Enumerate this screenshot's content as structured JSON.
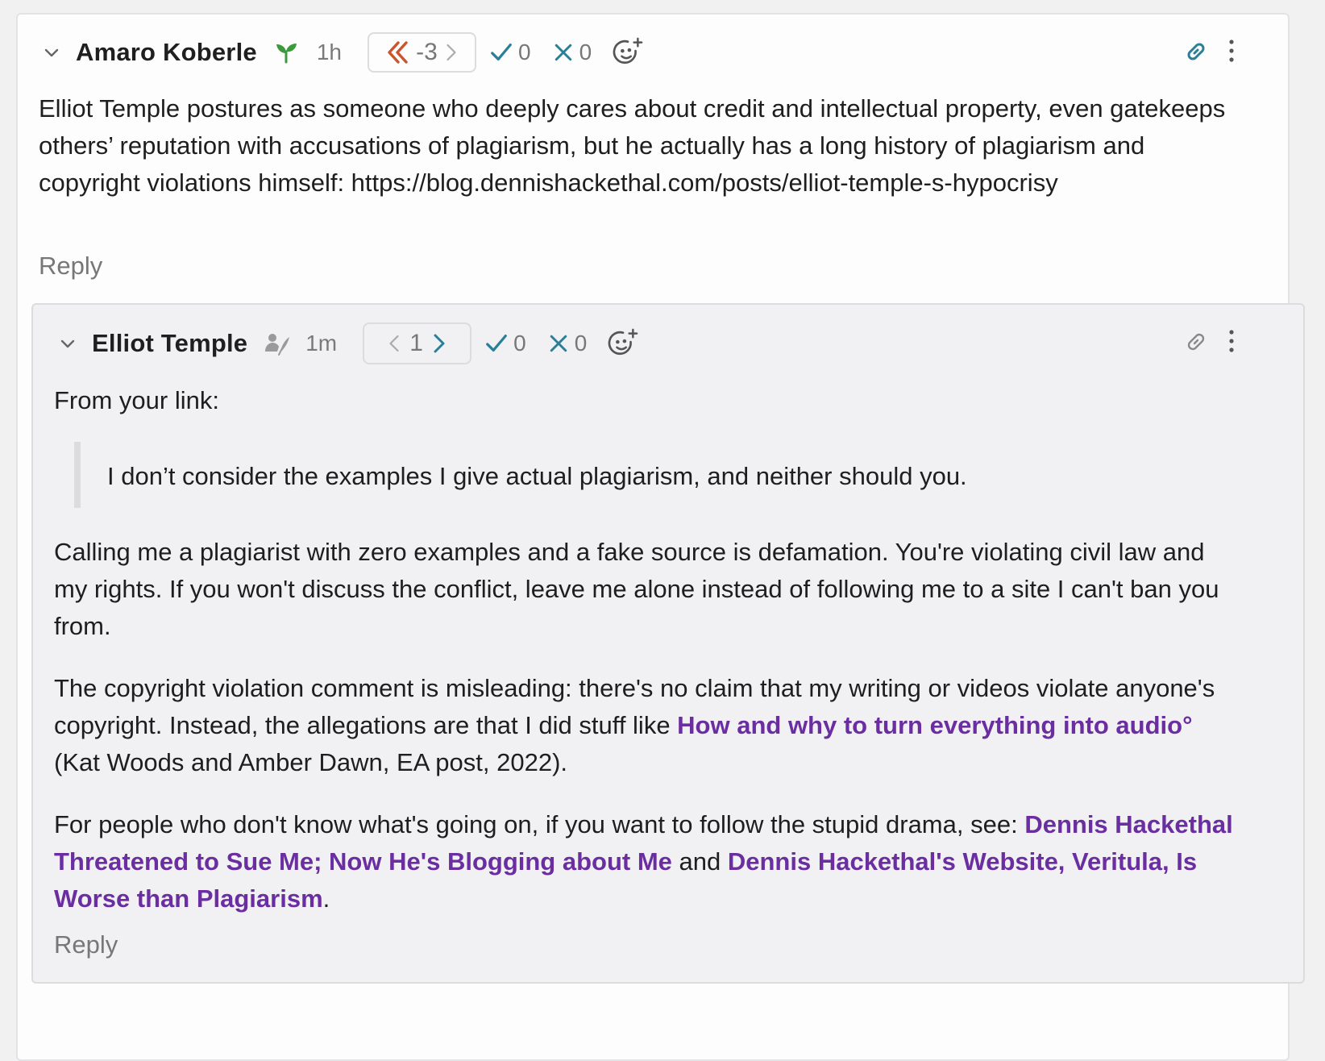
{
  "top_comment": {
    "author": "Amaro Koberle",
    "time": "1h",
    "score": "-3",
    "agree_count": "0",
    "disagree_count": "0",
    "body": "Elliot Temple postures as someone who deeply cares about credit and intellectual property, even gatekeeps others’ reputation with accusations of plagiarism, but he actually has a long history of plagiarism and copyright violations himself: https://blog.dennishackethal.com/posts/elliot-temple-s-hypocrisy",
    "reply_label": "Reply",
    "icons": [
      "chevron-down-icon",
      "sprout-icon",
      "double-chevron-left-icon",
      "chevron-right-icon",
      "check-icon",
      "x-icon",
      "add-emoji-icon",
      "link-icon",
      "kebab-menu-icon"
    ]
  },
  "reply_comment": {
    "author": "Elliot Temple",
    "time": "1m",
    "score": "1",
    "agree_count": "0",
    "disagree_count": "0",
    "intro": "From your link:",
    "quote": "I don’t consider the examples I give actual plagiarism, and neither should you.",
    "para1": "Calling me a plagiarist with zero examples and a fake source is defamation. You're violating civil law and my rights. If you won't discuss the conflict, leave me alone instead of following me to a site I can't ban you from.",
    "para2_before": "The copyright violation comment is misleading: there's no claim that my writing or videos violate anyone's copyright. Instead, the allegations are that I did stuff like ",
    "para2_link": "How and why to turn everything into audio",
    "para2_link_mark": "°",
    "para2_after": " (Kat Woods and Amber Dawn, EA post, 2022).",
    "para3_before": "For people who don't know what's going on, if you want to follow the stupid drama, see: ",
    "para3_link1": "Dennis Hackethal Threatened to Sue Me; Now He's Blogging about Me",
    "para3_mid": " and ",
    "para3_link2": "Dennis Hackethal's Website, Veritula, Is Worse than Plagiarism",
    "para3_end": ".",
    "reply_label": "Reply",
    "icons": [
      "chevron-down-icon",
      "user-feather-icon",
      "chevron-left-icon",
      "chevron-right-icon",
      "check-icon",
      "x-icon",
      "add-emoji-icon",
      "link-icon",
      "kebab-menu-icon"
    ]
  },
  "colors": {
    "link": "#6a2ea0",
    "vote_accent": "#c8552b",
    "check": "#2a7f98",
    "sprout": "#3b9a3b",
    "link_icon_active": "#2a7f98"
  }
}
